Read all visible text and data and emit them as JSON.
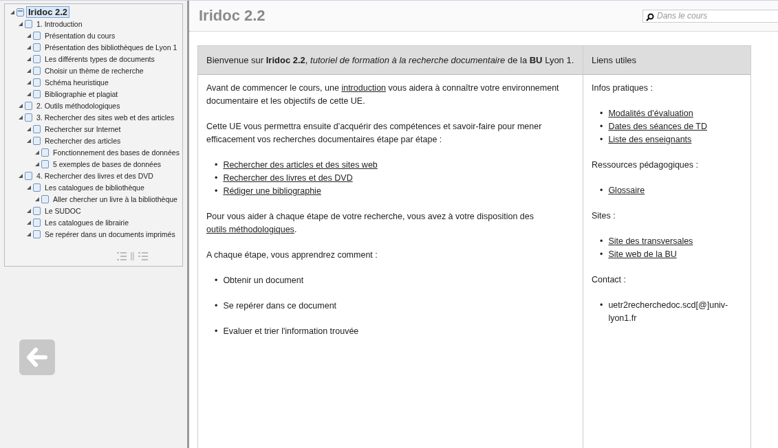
{
  "tree": {
    "label": "Iridoc 2.2",
    "selected": true,
    "children": [
      {
        "label": "1. Introduction",
        "selected": false,
        "children": [
          {
            "label": "Présentation du cours",
            "selected": false
          },
          {
            "label": "Présentation des bibliothèques de Lyon 1",
            "selected": false
          },
          {
            "label": "Les différents types de documents",
            "selected": false
          },
          {
            "label": "Choisir un thème de recherche",
            "selected": false
          },
          {
            "label": "Schéma heuristique",
            "selected": false
          },
          {
            "label": "Bibliographie et plagiat",
            "selected": false
          }
        ]
      },
      {
        "label": "2. Outils méthodologiques",
        "selected": false
      },
      {
        "label": "3. Rechercher des sites web et des articles",
        "selected": false,
        "children": [
          {
            "label": "Rechercher sur Internet",
            "selected": false
          },
          {
            "label": "Rechercher des articles",
            "selected": false,
            "children": [
              {
                "label": "Fonctionnement des bases de données",
                "selected": false
              },
              {
                "label": "5 exemples de bases de données",
                "selected": false
              }
            ]
          }
        ]
      },
      {
        "label": "4. Rechercher des livres et des DVD",
        "selected": false,
        "children": [
          {
            "label": "Les catalogues de bibliothèque",
            "selected": false,
            "children": [
              {
                "label": "Aller chercher un livre à la bibliothèque",
                "selected": false
              }
            ]
          },
          {
            "label": "Le SUDOC",
            "selected": false
          },
          {
            "label": "Les catalogues de librairie",
            "selected": false
          },
          {
            "label": "Se repérer dans un documents imprimés",
            "selected": false
          }
        ]
      }
    ]
  },
  "page_title": "Iridoc 2.2",
  "search": {
    "placeholder": "Dans le cours"
  },
  "main_header": "Bienvenue sur **Iridoc 2.2**, *tutoriel de formation à la recherche documentaire* de la **BU** Lyon 1.",
  "main_blocks": [
    {
      "kind": "paragraph",
      "parts": [
        {
          "kind": "text",
          "text": "Avant de commencer le cours, une "
        },
        {
          "kind": "link",
          "text": "introduction"
        },
        {
          "kind": "text",
          "text": " vous aidera à connaître votre environnement documentaire et les objectifs de cette UE."
        }
      ]
    },
    {
      "kind": "paragraph",
      "parts": [
        {
          "kind": "text",
          "text": "Cette UE vous permettra ensuite d'acquérir des compétences et savoir-faire pour mener efficacement vos recherches documentaires étape par étape :"
        }
      ]
    },
    {
      "kind": "list",
      "items": [
        {
          "bullet": "•",
          "kind": "link",
          "text": "Rechercher des articles et des sites web"
        },
        {
          "bullet": "•",
          "kind": "link",
          "text": "Rechercher des livres et des DVD"
        },
        {
          "bullet": "•",
          "kind": "link",
          "text": "Rédiger une bibliographie"
        }
      ]
    },
    {
      "kind": "paragraph",
      "parts": [
        {
          "kind": "text",
          "text": "Pour vous aider à chaque étape de votre recherche, vous avez à votre disposition des "
        },
        {
          "kind": "link",
          "text": "outils méthodologiques"
        },
        {
          "kind": "text",
          "text": "."
        }
      ]
    },
    {
      "kind": "paragraph",
      "parts": [
        {
          "kind": "text",
          "text": "A chaque étape, vous apprendrez comment :"
        }
      ]
    },
    {
      "kind": "spaced_list",
      "items": [
        {
          "bullet": "•",
          "kind": "text",
          "text": "Obtenir un document"
        },
        {
          "bullet": "•",
          "kind": "text",
          "text": "Se repérer dans ce document"
        },
        {
          "bullet": "•",
          "kind": "text",
          "text": "Evaluer et trier l'information trouvée"
        }
      ]
    }
  ],
  "side_header": "Liens utiles",
  "side_blocks": [
    {
      "kind": "heading",
      "text": "Infos pratiques :"
    },
    {
      "kind": "list",
      "items": [
        {
          "bullet": "•",
          "kind": "link",
          "text": "Modalités d'évaluation"
        },
        {
          "bullet": "•",
          "kind": "link",
          "text": "Dates des séances de TD"
        },
        {
          "bullet": "•",
          "kind": "link",
          "text": "Liste des enseignants"
        }
      ]
    },
    {
      "kind": "heading",
      "text": "Ressources pédagogiques :"
    },
    {
      "kind": "list",
      "items": [
        {
          "bullet": "•",
          "kind": "link",
          "text": "Glossaire"
        }
      ]
    },
    {
      "kind": "heading",
      "text": "Sites :"
    },
    {
      "kind": "list",
      "items": [
        {
          "bullet": "•",
          "kind": "link",
          "text": "Site des transversales"
        },
        {
          "bullet": "•",
          "kind": "link",
          "text": "Site web de la BU"
        }
      ]
    },
    {
      "kind": "heading",
      "text": "Contact :"
    },
    {
      "kind": "list",
      "items": [
        {
          "bullet": "•",
          "kind": "text",
          "text": "uetr2recherchedoc.scd[@]univ-lyon1.fr"
        }
      ]
    }
  ]
}
